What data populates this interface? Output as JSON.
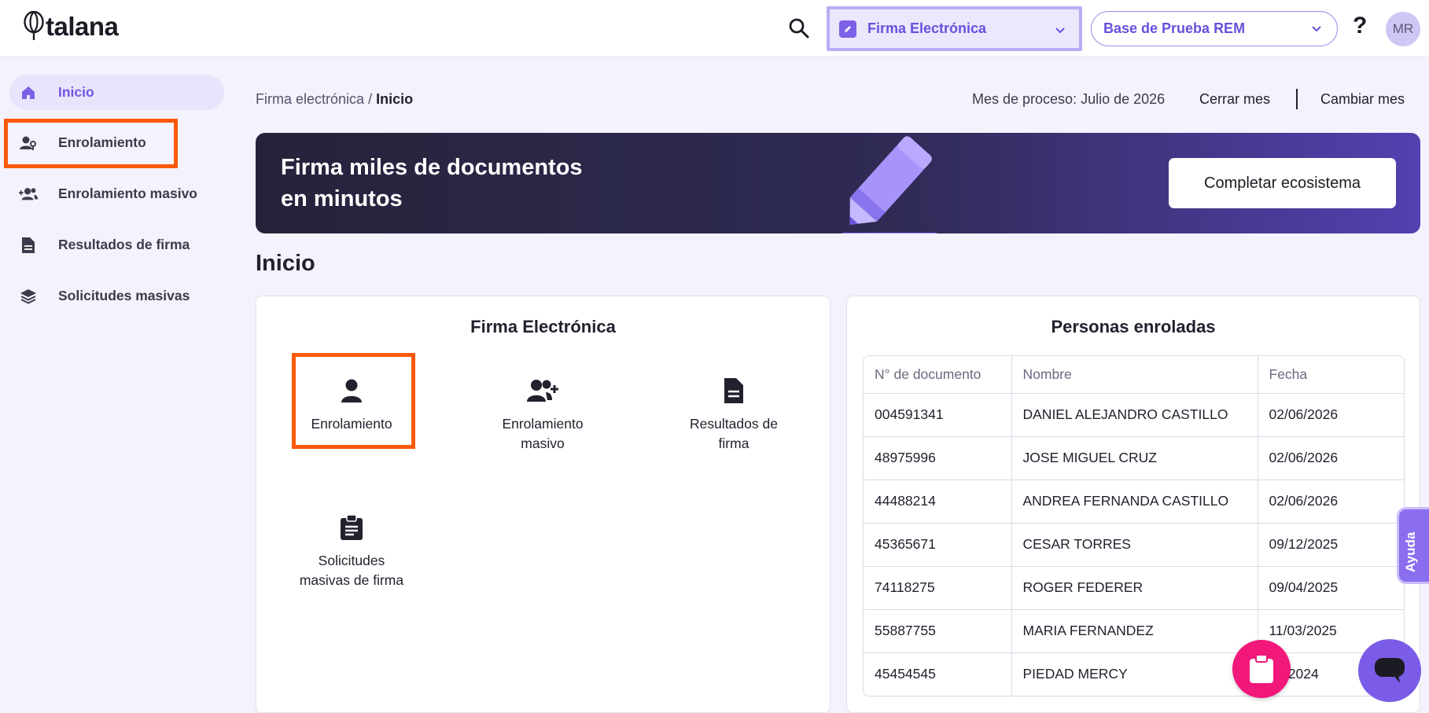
{
  "header": {
    "logo_text": "talana",
    "product_selector": {
      "label": "Firma Electrónica"
    },
    "base_selector": {
      "label": "Base de Prueba REM"
    },
    "help_label": "?",
    "avatar_initials": "MR"
  },
  "sidebar": {
    "items": [
      {
        "label": "Inicio",
        "icon": "home-icon",
        "active": true
      },
      {
        "label": "Enrolamiento",
        "icon": "user-key-icon"
      },
      {
        "label": "Enrolamiento masivo",
        "icon": "users-add-icon"
      },
      {
        "label": "Resultados de firma",
        "icon": "document-icon"
      },
      {
        "label": "Solicitudes masivas",
        "icon": "layers-icon"
      }
    ]
  },
  "breadcrumb": {
    "parent": "Firma electrónica",
    "separator": "/",
    "current": "Inicio"
  },
  "process": {
    "label": "Mes de proceso: Julio de 2026",
    "close_label": "Cerrar mes",
    "change_label": "Cambiar mes"
  },
  "banner": {
    "title_line1": "Firma miles de documentos",
    "title_line2": "en minutos",
    "button_label": "Completar ecosistema"
  },
  "page_title": "Inicio",
  "modules_card": {
    "title": "Firma Electrónica",
    "tiles": [
      {
        "label_line1": "Enrolamiento",
        "label_line2": "",
        "icon": "user-icon"
      },
      {
        "label_line1": "Enrolamiento",
        "label_line2": "masivo",
        "icon": "user-plus-icon"
      },
      {
        "label_line1": "Resultados de",
        "label_line2": "firma",
        "icon": "document-icon"
      },
      {
        "label_line1": "Solicitudes",
        "label_line2": "masivas de firma",
        "icon": "clipboard-icon"
      }
    ]
  },
  "enrolled_card": {
    "title": "Personas enroladas",
    "columns": [
      "N° de documento",
      "Nombre",
      "Fecha"
    ],
    "rows": [
      [
        "004591341",
        "DANIEL ALEJANDRO CASTILLO",
        "02/06/2026"
      ],
      [
        "48975996",
        "JOSE MIGUEL CRUZ",
        "02/06/2026"
      ],
      [
        "44488214",
        "ANDREA FERNANDA CASTILLO",
        "02/06/2026"
      ],
      [
        "45365671",
        "CESAR TORRES",
        "09/12/2025"
      ],
      [
        "74118275",
        "ROGER FEDERER",
        "09/04/2025"
      ],
      [
        "55887755",
        "MARIA FERNANDEZ",
        "11/03/2025"
      ],
      [
        "45454545",
        "PIEDAD MERCY",
        "05/2024"
      ]
    ]
  },
  "ayuda_label": "Ayuda",
  "colors": {
    "accent": "#7c61e6",
    "highlight": "#fb5a0b",
    "banner_dark": "#25233a",
    "fab_pink": "#f2177a"
  }
}
